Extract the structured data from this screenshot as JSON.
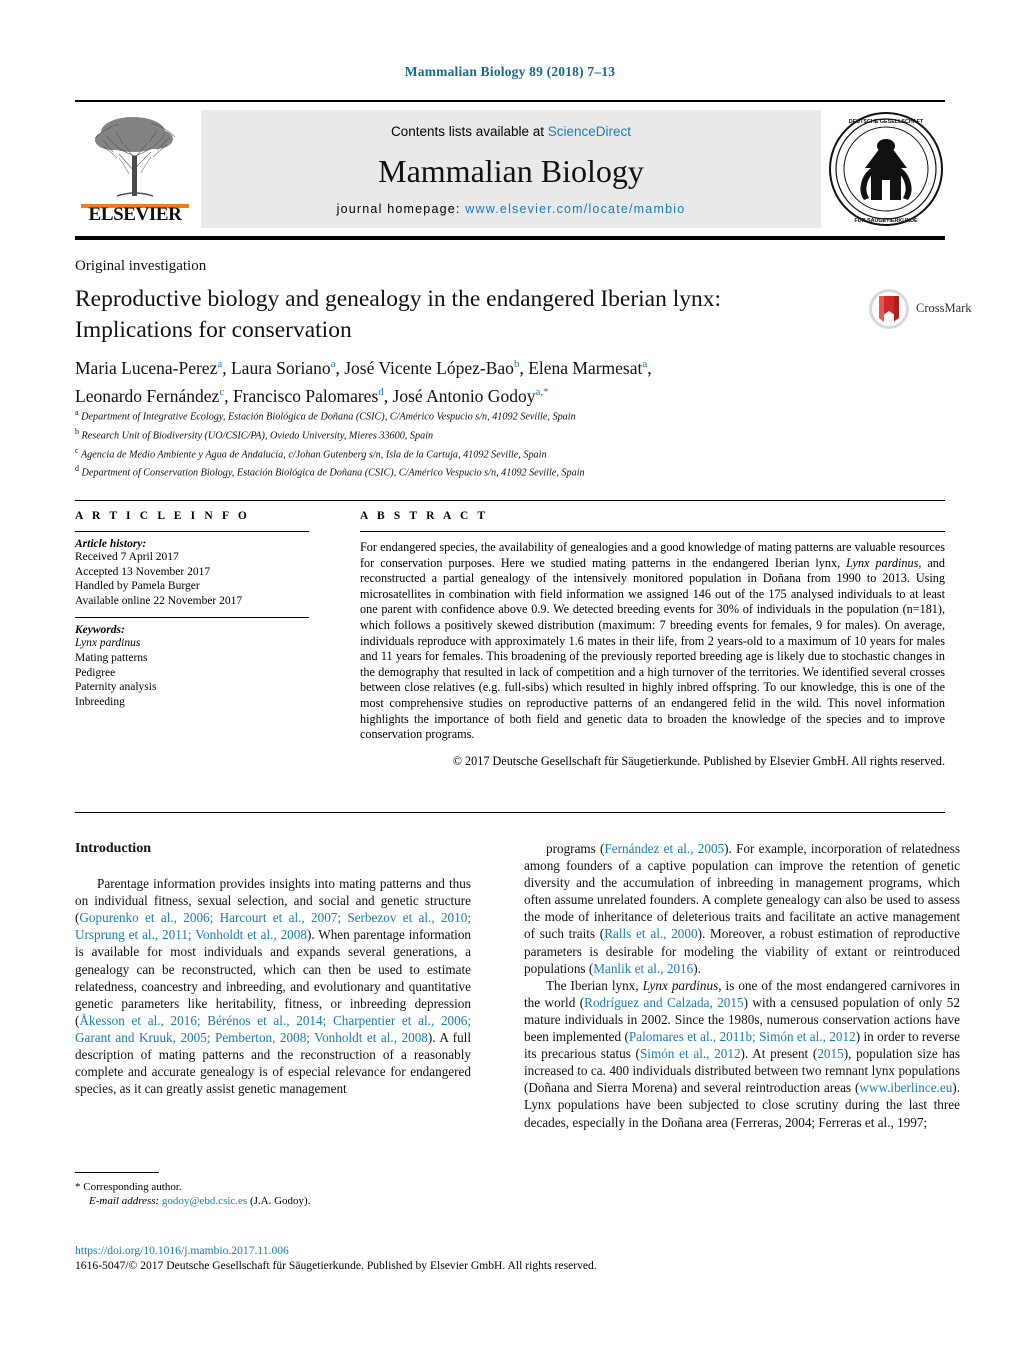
{
  "running_head": "Mammalian Biology 89 (2018) 7–13",
  "masthead": {
    "publisher_name": "ELSEVIER",
    "contents_prefix": "Contents lists available at ",
    "contents_link": "ScienceDirect",
    "journal_title": "Mammalian Biology",
    "homepage_prefix": "journal homepage: ",
    "homepage_url": "www.elsevier.com/locate/mambio",
    "society_logo_text": "DEUTSCHE GESELLSCHAFT FÜR SÄUGETIERKUNDE"
  },
  "article": {
    "type": "Original investigation",
    "title_line1": "Reproductive biology and genealogy in the endangered Iberian lynx:",
    "title_line2": "Implications for conservation",
    "crossmark_label": "CrossMark"
  },
  "authors": [
    {
      "name": "Maria Lucena-Perez",
      "sup": "a",
      "sep": ", "
    },
    {
      "name": "Laura Soriano",
      "sup": "a",
      "sep": ", "
    },
    {
      "name": "José Vicente López-Bao",
      "sup": "b",
      "sep": ", "
    },
    {
      "name": "Elena Marmesat",
      "sup": "a",
      "sep": ", "
    },
    {
      "name": "Leonardo Fernández",
      "sup": "c",
      "sep": ", "
    },
    {
      "name": "Francisco Palomares",
      "sup": "d",
      "sep": ", "
    },
    {
      "name": "José Antonio Godoy",
      "sup": "a,*",
      "sep": ""
    }
  ],
  "affiliations": [
    {
      "mark": "a",
      "text": "Department of Integrative Ecology, Estación Biológica de Doñana (CSIC), C/Américo Vespucio s/n, 41092 Seville, Spain"
    },
    {
      "mark": "b",
      "text": "Research Unit of Biodiversity (UO/CSIC/PA), Oviedo University, Mieres 33600, Spain"
    },
    {
      "mark": "c",
      "text": "Agencia de Medio Ambiente y Agua de Andalucía, c/Johan Gutenberg s/n, Isla de la Cartuja, 41092 Seville, Spain"
    },
    {
      "mark": "d",
      "text": "Department of Conservation Biology, Estación Biológica de Doñana (CSIC), C/Américo Vespucio s/n, 41092 Seville, Spain"
    }
  ],
  "article_info": {
    "heading": "A R T I C L E    I N F O",
    "history_label": "Article history:",
    "history": [
      "Received 7 April 2017",
      "Accepted 13 November 2017",
      "Handled by Pamela Burger",
      "Available online 22 November 2017"
    ],
    "keywords_label": "Keywords:",
    "keywords": [
      "Lynx pardinus",
      "Mating patterns",
      "Pedigree",
      "Paternity analysis",
      "Inbreeding"
    ]
  },
  "abstract": {
    "heading": "A B S T R A C T",
    "text": "For endangered species, the availability of genealogies and a good knowledge of mating patterns are valuable resources for conservation purposes. Here we studied mating patterns in the endangered Iberian lynx, Lynx pardinus, and reconstructed a partial genealogy of the intensively monitored population in Doñana from 1990 to 2013. Using microsatellites in combination with field information we assigned 146 out of the 175 analysed individuals to at least one parent with confidence above 0.9. We detected breeding events for 30% of individuals in the population (n=181), which follows a positively skewed distribution (maximum: 7 breeding events for females, 9 for males). On average, individuals reproduce with approximately 1.6 mates in their life, from 2 years-old to a maximum of 10 years for males and 11 years for females. This broadening of the previously reported breeding age is likely due to stochastic changes in the demography that resulted in lack of competition and a high turnover of the territories. We identified several crosses between close relatives (e.g. full-sibs) which resulted in highly inbred offspring. To our knowledge, this is one of the most comprehensive studies on reproductive patterns of an endangered felid in the wild. This novel information highlights the importance of both field and genetic data to broaden the knowledge of the species and to improve conservation programs.",
    "copyright": "© 2017 Deutsche Gesellschaft für Säugetierkunde. Published by Elsevier GmbH. All rights reserved."
  },
  "body": {
    "section_heading": "Introduction",
    "left_paragraphs": [
      "Parentage information provides insights into mating patterns and thus on individual fitness, sexual selection, and social and genetic structure (Gopurenko et al., 2006; Harcourt et al., 2007; Serbezov et al., 2010; Ursprung et al., 2011; Vonholdt et al., 2008). When parentage information is available for most individuals and expands several generations, a genealogy can be reconstructed, which can then be used to estimate relatedness, coancestry and inbreeding, and evolutionary and quantitative genetic parameters like heritability, fitness, or inbreeding depression (Åkesson et al., 2016; Bérénos et al., 2014; Charpentier et al., 2006; Garant and Kruuk, 2005; Pemberton, 2008; Vonholdt et al., 2008). A full description of mating patterns and the reconstruction of a reasonably complete and accurate genealogy is of especial relevance for endangered species, as it can greatly assist genetic management"
    ],
    "right_paragraphs": [
      "programs (Fernández et al., 2005). For example, incorporation of relatedness among founders of a captive population can improve the retention of genetic diversity and the accumulation of inbreeding in management programs, which often assume unrelated founders. A complete genealogy can also be used to assess the mode of inheritance of deleterious traits and facilitate an active management of such traits (Ralls et al., 2000). Moreover, a robust estimation of reproductive parameters is desirable for modeling the viability of extant or reintroduced populations (Manlik et al., 2016).",
      "The Iberian lynx, Lynx pardinus, is one of the most endangered carnivores in the world (Rodríguez and Calzada, 2015) with a censused population of only 52 mature individuals in 2002. Since the 1980s, numerous conservation actions have been implemented (Palomares et al., 2011b; Simón et al., 2012) in order to reverse its precarious status (Simón et al., 2012). At present (2015), population size has increased to ca. 400 individuals distributed between two remnant lynx populations (Doñana and Sierra Morena) and several reintroduction areas (www.iberlince.eu). Lynx populations have been subjected to close scrutiny during the last three decades, especially in the Doñana area (Ferreras, 2004; Ferreras et al., 1997;"
    ]
  },
  "footnote": {
    "corresponding": "* Corresponding author.",
    "email_label": "E-mail address:",
    "email": "godoy@ebd.csic.es",
    "email_owner": "(J.A. Godoy)."
  },
  "footer": {
    "doi": "https://doi.org/10.1016/j.mambio.2017.11.006",
    "issn_line": "1616-5047/© 2017 Deutsche Gesellschaft für Säugetierkunde. Published by Elsevier GmbH. All rights reserved."
  },
  "colors": {
    "link": "#1a7bb9",
    "runhead": "#13698f",
    "elsevier_orange": "#f47920"
  }
}
